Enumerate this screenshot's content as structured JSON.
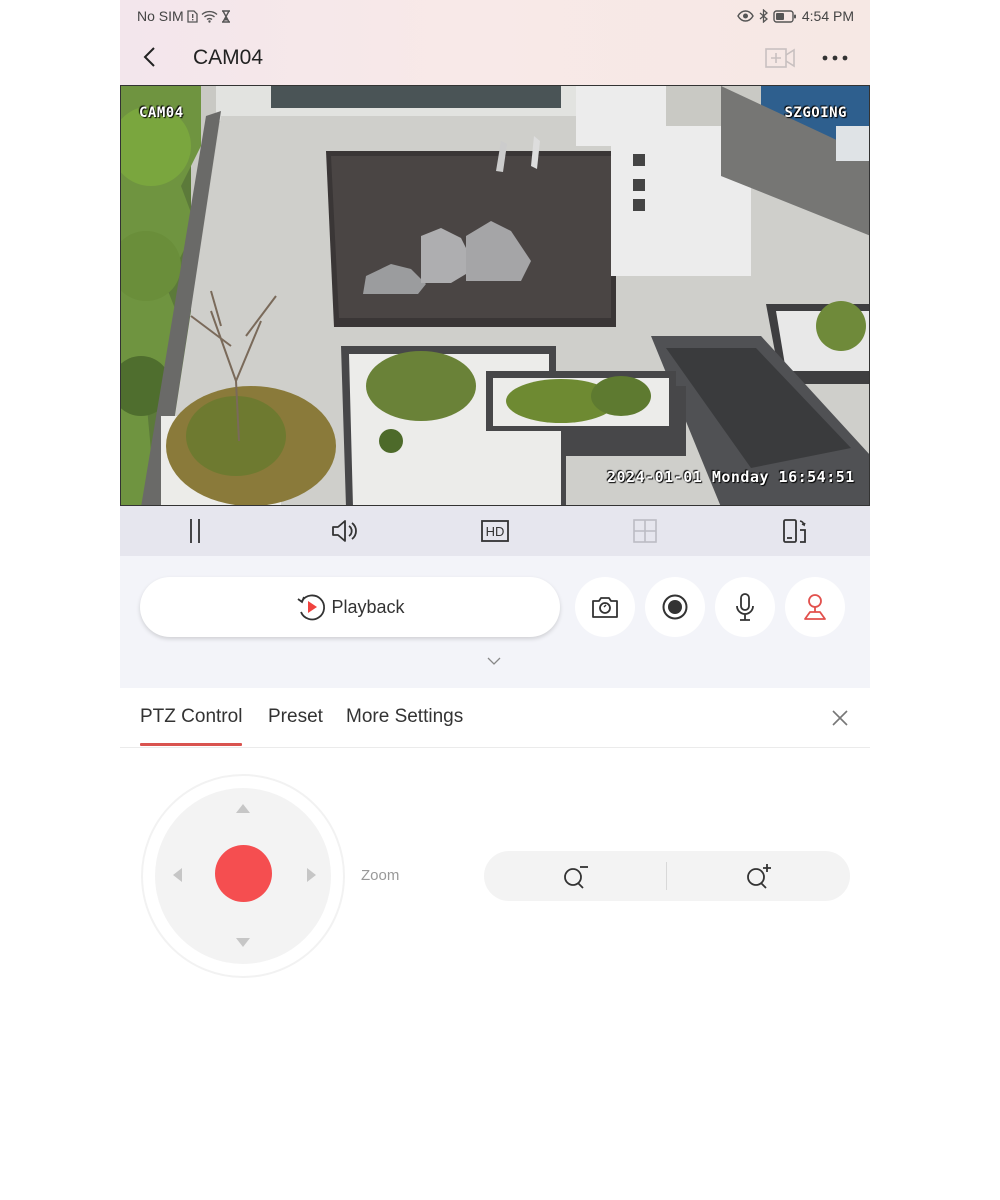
{
  "status_bar": {
    "carrier": "No SIM",
    "time": "4:54 PM",
    "icons": [
      "sim-alert-icon",
      "wifi-icon",
      "hourglass-icon",
      "eye-icon",
      "bluetooth-icon",
      "battery-icon"
    ]
  },
  "header": {
    "title": "CAM04",
    "back_icon": "chevron-left-icon",
    "add_camera_icon": "add-video-icon",
    "more_icon": "more-horizontal-icon"
  },
  "video": {
    "osd_channel": "CAM04",
    "osd_brand": "SZGOING",
    "osd_timestamp": "2024-01-01 Monday 16:54:51"
  },
  "player_toolbar": {
    "items": [
      {
        "name": "pause",
        "icon": "pause-icon"
      },
      {
        "name": "sound",
        "icon": "speaker-icon"
      },
      {
        "name": "hd",
        "icon": "hd-icon",
        "label": "HD"
      },
      {
        "name": "split",
        "icon": "grid-icon",
        "disabled": true
      },
      {
        "name": "rotate",
        "icon": "rotate-screen-icon"
      }
    ]
  },
  "actions": {
    "playback_label": "Playback",
    "buttons": [
      {
        "name": "snapshot",
        "icon": "camera-icon"
      },
      {
        "name": "record",
        "icon": "record-icon"
      },
      {
        "name": "talk",
        "icon": "microphone-icon"
      },
      {
        "name": "ptz",
        "icon": "ptz-icon",
        "active": true
      }
    ]
  },
  "tabs": {
    "items": [
      {
        "label": "PTZ Control",
        "active": true
      },
      {
        "label": "Preset",
        "active": false
      },
      {
        "label": "More Settings",
        "active": false
      }
    ]
  },
  "ptz": {
    "zoom_label": "Zoom",
    "zoom_out_icon": "zoom-out-icon",
    "zoom_in_icon": "zoom-in-icon"
  },
  "colors": {
    "accent": "#f54e50",
    "tab_underline": "#d9534f",
    "toolbar_bg": "#e6e6ee",
    "panel_bg": "#f3f4f9"
  }
}
